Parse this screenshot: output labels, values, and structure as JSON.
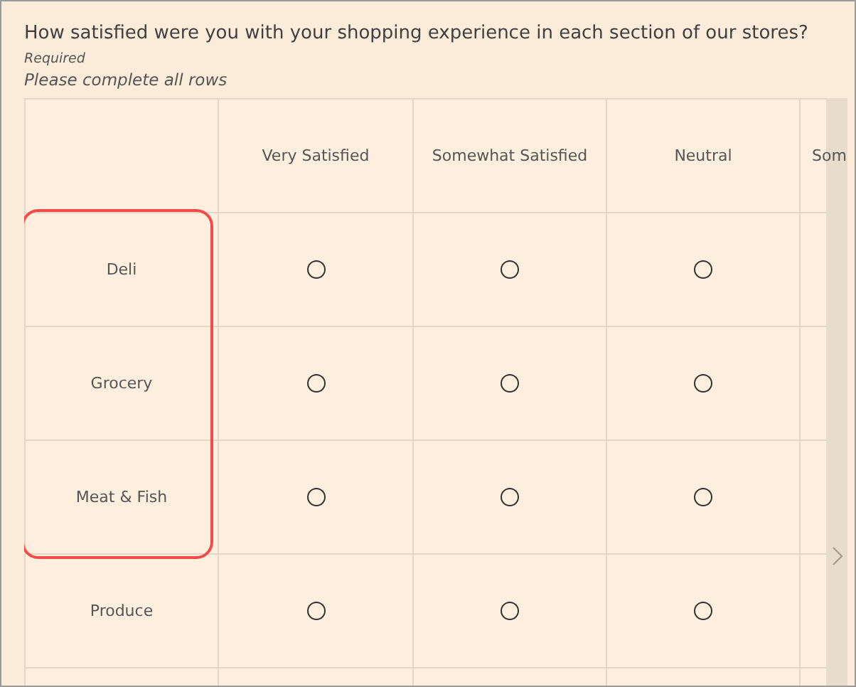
{
  "question": "How satisfied were you with your shopping experience in each section of our stores?",
  "required_note": "Required",
  "instruction": "Please complete all rows",
  "columns": [
    "Very Satisfied",
    "Somewhat Satisfied",
    "Neutral",
    "Som"
  ],
  "rows": [
    {
      "label": "Deli",
      "highlighted": true,
      "options": [
        {
          "selected": false
        },
        {
          "selected": false
        },
        {
          "selected": false
        }
      ]
    },
    {
      "label": "Grocery",
      "highlighted": true,
      "options": [
        {
          "selected": false
        },
        {
          "selected": false
        },
        {
          "selected": false
        }
      ]
    },
    {
      "label": "Meat & Fish",
      "highlighted": true,
      "options": [
        {
          "selected": false
        },
        {
          "selected": false
        },
        {
          "selected": false
        }
      ]
    },
    {
      "label": "Produce",
      "highlighted": false,
      "options": [
        {
          "selected": false
        },
        {
          "selected": false
        },
        {
          "selected": false
        }
      ]
    }
  ]
}
